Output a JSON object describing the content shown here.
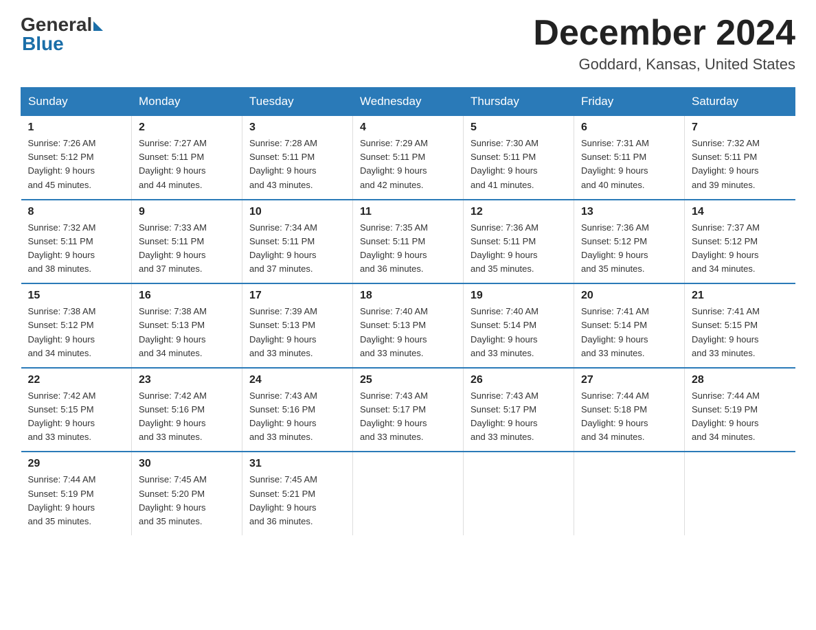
{
  "logo": {
    "general": "General",
    "blue": "Blue"
  },
  "title": "December 2024",
  "location": "Goddard, Kansas, United States",
  "days_header": [
    "Sunday",
    "Monday",
    "Tuesday",
    "Wednesday",
    "Thursday",
    "Friday",
    "Saturday"
  ],
  "weeks": [
    [
      {
        "day": "1",
        "info": "Sunrise: 7:26 AM\nSunset: 5:12 PM\nDaylight: 9 hours\nand 45 minutes."
      },
      {
        "day": "2",
        "info": "Sunrise: 7:27 AM\nSunset: 5:11 PM\nDaylight: 9 hours\nand 44 minutes."
      },
      {
        "day": "3",
        "info": "Sunrise: 7:28 AM\nSunset: 5:11 PM\nDaylight: 9 hours\nand 43 minutes."
      },
      {
        "day": "4",
        "info": "Sunrise: 7:29 AM\nSunset: 5:11 PM\nDaylight: 9 hours\nand 42 minutes."
      },
      {
        "day": "5",
        "info": "Sunrise: 7:30 AM\nSunset: 5:11 PM\nDaylight: 9 hours\nand 41 minutes."
      },
      {
        "day": "6",
        "info": "Sunrise: 7:31 AM\nSunset: 5:11 PM\nDaylight: 9 hours\nand 40 minutes."
      },
      {
        "day": "7",
        "info": "Sunrise: 7:32 AM\nSunset: 5:11 PM\nDaylight: 9 hours\nand 39 minutes."
      }
    ],
    [
      {
        "day": "8",
        "info": "Sunrise: 7:32 AM\nSunset: 5:11 PM\nDaylight: 9 hours\nand 38 minutes."
      },
      {
        "day": "9",
        "info": "Sunrise: 7:33 AM\nSunset: 5:11 PM\nDaylight: 9 hours\nand 37 minutes."
      },
      {
        "day": "10",
        "info": "Sunrise: 7:34 AM\nSunset: 5:11 PM\nDaylight: 9 hours\nand 37 minutes."
      },
      {
        "day": "11",
        "info": "Sunrise: 7:35 AM\nSunset: 5:11 PM\nDaylight: 9 hours\nand 36 minutes."
      },
      {
        "day": "12",
        "info": "Sunrise: 7:36 AM\nSunset: 5:11 PM\nDaylight: 9 hours\nand 35 minutes."
      },
      {
        "day": "13",
        "info": "Sunrise: 7:36 AM\nSunset: 5:12 PM\nDaylight: 9 hours\nand 35 minutes."
      },
      {
        "day": "14",
        "info": "Sunrise: 7:37 AM\nSunset: 5:12 PM\nDaylight: 9 hours\nand 34 minutes."
      }
    ],
    [
      {
        "day": "15",
        "info": "Sunrise: 7:38 AM\nSunset: 5:12 PM\nDaylight: 9 hours\nand 34 minutes."
      },
      {
        "day": "16",
        "info": "Sunrise: 7:38 AM\nSunset: 5:13 PM\nDaylight: 9 hours\nand 34 minutes."
      },
      {
        "day": "17",
        "info": "Sunrise: 7:39 AM\nSunset: 5:13 PM\nDaylight: 9 hours\nand 33 minutes."
      },
      {
        "day": "18",
        "info": "Sunrise: 7:40 AM\nSunset: 5:13 PM\nDaylight: 9 hours\nand 33 minutes."
      },
      {
        "day": "19",
        "info": "Sunrise: 7:40 AM\nSunset: 5:14 PM\nDaylight: 9 hours\nand 33 minutes."
      },
      {
        "day": "20",
        "info": "Sunrise: 7:41 AM\nSunset: 5:14 PM\nDaylight: 9 hours\nand 33 minutes."
      },
      {
        "day": "21",
        "info": "Sunrise: 7:41 AM\nSunset: 5:15 PM\nDaylight: 9 hours\nand 33 minutes."
      }
    ],
    [
      {
        "day": "22",
        "info": "Sunrise: 7:42 AM\nSunset: 5:15 PM\nDaylight: 9 hours\nand 33 minutes."
      },
      {
        "day": "23",
        "info": "Sunrise: 7:42 AM\nSunset: 5:16 PM\nDaylight: 9 hours\nand 33 minutes."
      },
      {
        "day": "24",
        "info": "Sunrise: 7:43 AM\nSunset: 5:16 PM\nDaylight: 9 hours\nand 33 minutes."
      },
      {
        "day": "25",
        "info": "Sunrise: 7:43 AM\nSunset: 5:17 PM\nDaylight: 9 hours\nand 33 minutes."
      },
      {
        "day": "26",
        "info": "Sunrise: 7:43 AM\nSunset: 5:17 PM\nDaylight: 9 hours\nand 33 minutes."
      },
      {
        "day": "27",
        "info": "Sunrise: 7:44 AM\nSunset: 5:18 PM\nDaylight: 9 hours\nand 34 minutes."
      },
      {
        "day": "28",
        "info": "Sunrise: 7:44 AM\nSunset: 5:19 PM\nDaylight: 9 hours\nand 34 minutes."
      }
    ],
    [
      {
        "day": "29",
        "info": "Sunrise: 7:44 AM\nSunset: 5:19 PM\nDaylight: 9 hours\nand 35 minutes."
      },
      {
        "day": "30",
        "info": "Sunrise: 7:45 AM\nSunset: 5:20 PM\nDaylight: 9 hours\nand 35 minutes."
      },
      {
        "day": "31",
        "info": "Sunrise: 7:45 AM\nSunset: 5:21 PM\nDaylight: 9 hours\nand 36 minutes."
      },
      {
        "day": "",
        "info": ""
      },
      {
        "day": "",
        "info": ""
      },
      {
        "day": "",
        "info": ""
      },
      {
        "day": "",
        "info": ""
      }
    ]
  ]
}
